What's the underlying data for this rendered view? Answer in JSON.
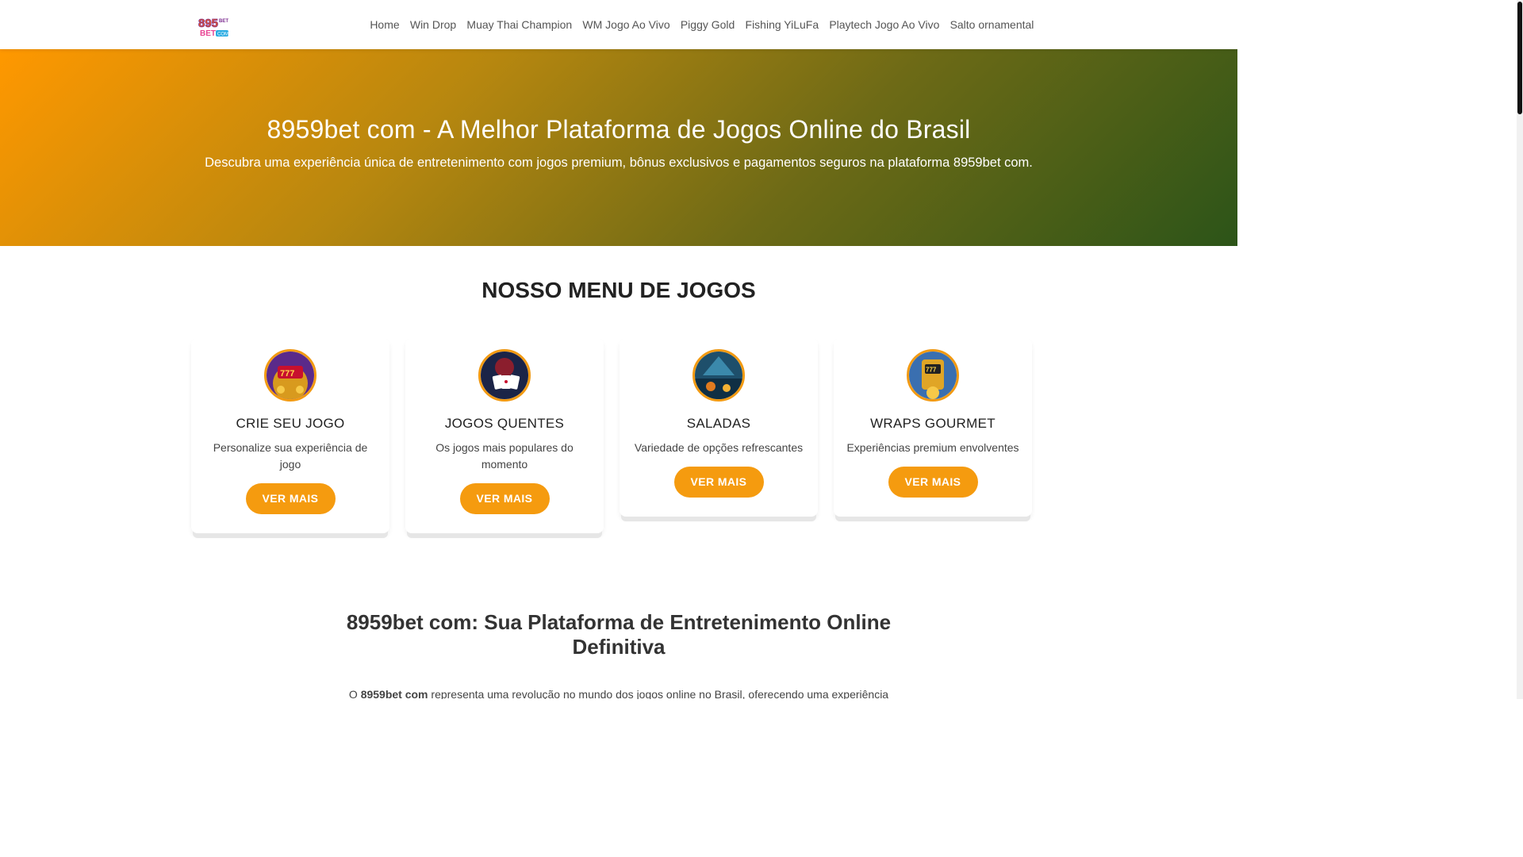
{
  "header": {
    "logo_text": "895BET.COM",
    "nav": [
      "Home",
      "Win Drop",
      "Muay Thai Champion",
      "WM Jogo Ao Vivo",
      "Piggy Gold",
      "Fishing YiLuFa",
      "Playtech Jogo Ao Vivo",
      "Salto ornamental"
    ]
  },
  "hero": {
    "title": "8959bet com - A Melhor Plataforma de Jogos Online do Brasil",
    "subtitle": "Descubra uma experiência única de entretenimento com jogos premium, bônus exclusivos e pagamentos seguros na plataforma 8959bet com."
  },
  "games": {
    "title": "NOSSO MENU DE JOGOS",
    "cards": [
      {
        "title": "CRIE SEU JOGO",
        "desc": "Personalize sua experiência de jogo",
        "button": "VER MAIS",
        "icon": "slot-777-icon"
      },
      {
        "title": "JOGOS QUENTES",
        "desc": "Os jogos mais populares do momento",
        "button": "VER MAIS",
        "icon": "casino-cards-icon"
      },
      {
        "title": "SALADAS",
        "desc": "Variedade de opções refrescantes",
        "button": "VER MAIS",
        "icon": "fishing-game-icon"
      },
      {
        "title": "WRAPS GOURMET",
        "desc": "Experiências premium envolventes",
        "button": "VER MAIS",
        "icon": "slot-machine-icon"
      }
    ]
  },
  "article": {
    "title": "8959bet com: Sua Plataforma de Entretenimento Online Definitiva",
    "text_prefix": "O ",
    "text_bold": "8959bet com",
    "text_rest": " representa uma revolução no mundo dos jogos online no Brasil, oferecendo uma experiência premium"
  },
  "colors": {
    "accent": "#f59b0f",
    "hero_start": "#ff9800",
    "hero_end": "#2c5418"
  }
}
